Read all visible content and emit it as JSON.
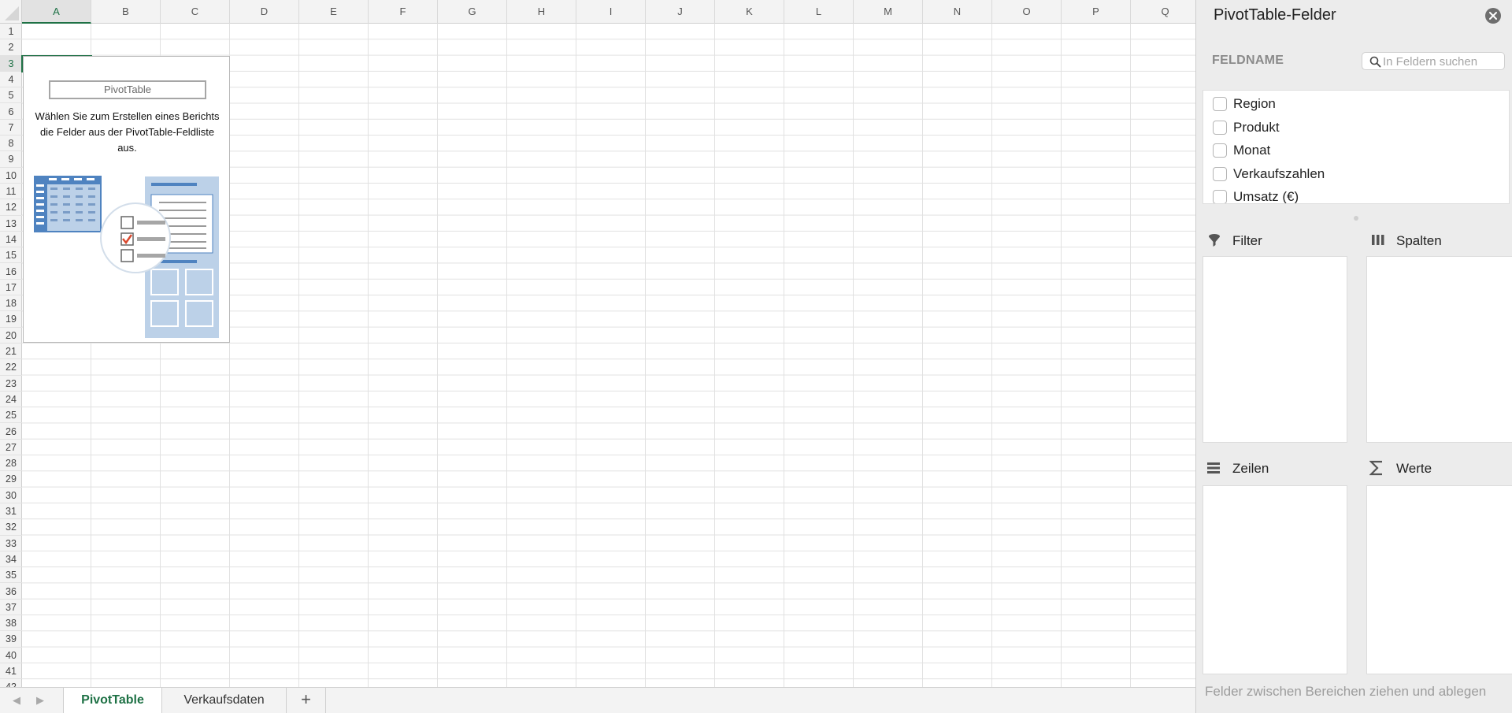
{
  "sheet": {
    "columns": [
      "A",
      "B",
      "C",
      "D",
      "E",
      "F",
      "G",
      "H",
      "I",
      "J",
      "K",
      "L",
      "M",
      "N",
      "O",
      "P",
      "Q"
    ],
    "rows": [
      "1",
      "2",
      "3",
      "4",
      "5",
      "6",
      "7",
      "8",
      "9",
      "10",
      "11",
      "12",
      "13",
      "14",
      "15",
      "16",
      "17",
      "18",
      "19",
      "20",
      "21",
      "22",
      "23",
      "24",
      "25",
      "26",
      "27",
      "28",
      "29",
      "30",
      "31",
      "32",
      "33",
      "34",
      "35",
      "36",
      "37",
      "38",
      "39",
      "40",
      "41",
      "42"
    ],
    "active_column": "A",
    "active_row": "3"
  },
  "pivot_placeholder": {
    "title": "PivotTable",
    "instructions": "Wählen Sie zum Erstellen eines Berichts die Felder aus der PivotTable-Feldliste aus."
  },
  "tabs": {
    "items": [
      {
        "label": "PivotTable",
        "active": true
      },
      {
        "label": "Verkaufsdaten",
        "active": false
      }
    ],
    "add_label": "+"
  },
  "pane": {
    "title": "PivotTable-Felder",
    "field_name_label": "FELDNAME",
    "search_placeholder": "In Feldern suchen",
    "fields": [
      {
        "label": "Region",
        "checked": false
      },
      {
        "label": "Produkt",
        "checked": false
      },
      {
        "label": "Monat",
        "checked": false
      },
      {
        "label": "Verkaufszahlen",
        "checked": false
      },
      {
        "label": "Umsatz (€)",
        "checked": false
      }
    ],
    "areas": {
      "filter": "Filter",
      "columns": "Spalten",
      "rows": "Zeilen",
      "values": "Werte"
    },
    "footer_hint": "Felder zwischen Bereichen ziehen und ablegen"
  },
  "colors": {
    "accent": "#1e7145",
    "illustration_blue": "#4f83c0",
    "illustration_light_blue": "#bcd1e8",
    "check_red": "#d9492f"
  }
}
